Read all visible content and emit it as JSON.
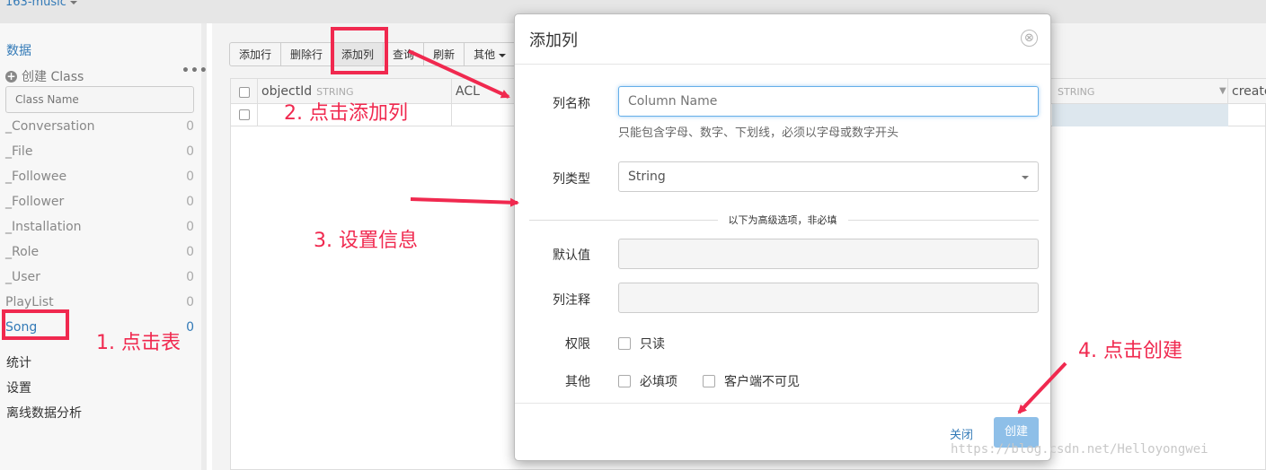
{
  "app": {
    "name": "163-music"
  },
  "sidebar": {
    "data_label": "数据",
    "create_class_label": "创建 Class",
    "more_label": "•••",
    "class_name_placeholder": "Class Name",
    "classes": [
      {
        "name": "_Conversation",
        "count": "0"
      },
      {
        "name": "_File",
        "count": "0"
      },
      {
        "name": "_Followee",
        "count": "0"
      },
      {
        "name": "_Follower",
        "count": "0"
      },
      {
        "name": "_Installation",
        "count": "0"
      },
      {
        "name": "_Role",
        "count": "0"
      },
      {
        "name": "_User",
        "count": "0"
      },
      {
        "name": "PlayList",
        "count": "0"
      },
      {
        "name": "Song",
        "count": "0",
        "active": true
      }
    ],
    "stats_label": "统计",
    "settings_label": "设置",
    "offline_label": "离线数据分析"
  },
  "toolbar": {
    "add_row": "添加行",
    "delete_row": "删除行",
    "add_column": "添加列",
    "query": "查询",
    "refresh": "刷新",
    "other": "其他"
  },
  "table": {
    "columns": [
      {
        "name": "objectId",
        "type": "STRING"
      },
      {
        "name": "ACL",
        "type": ""
      },
      {
        "name": "",
        "type": "STRING"
      },
      {
        "name": "create",
        "type": ""
      }
    ]
  },
  "modal": {
    "title": "添加列",
    "close_icon": "⊗",
    "column_name_label": "列名称",
    "column_name_placeholder": "Column Name",
    "column_name_help": "只能包含字母、数字、下划线，必须以字母或数字开头",
    "column_type_label": "列类型",
    "column_type_value": "String",
    "advanced_divider": "以下为高级选项，非必填",
    "default_value_label": "默认值",
    "comment_label": "列注释",
    "permission_label": "权限",
    "readonly_label": "只读",
    "other_label": "其他",
    "required_label": "必填项",
    "client_invisible_label": "客户端不可见",
    "close_button": "关闭",
    "create_button": "创建"
  },
  "annotations": {
    "step1": "1. 点击表",
    "step2": "2. 点击添加列",
    "step3": "3. 设置信息",
    "step4": "4. 点击创建",
    "color": "#f0294f"
  },
  "watermark": "https://blog.csdn.net/Helloyongwei"
}
